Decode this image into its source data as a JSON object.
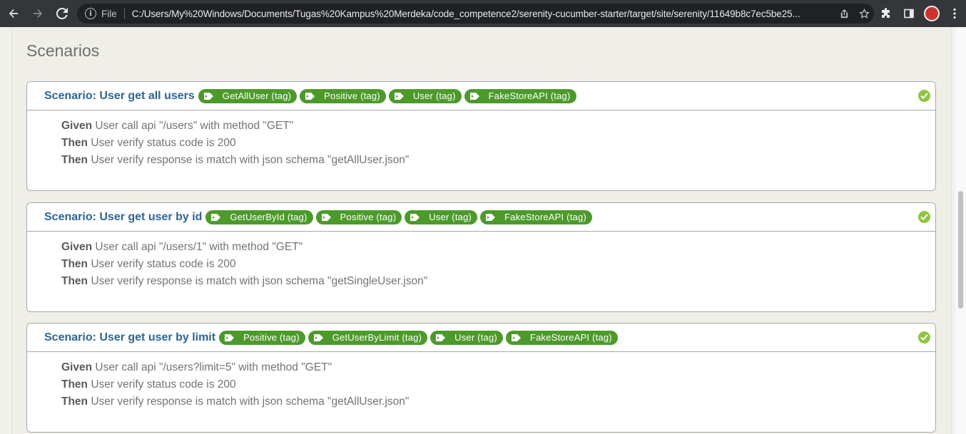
{
  "browser": {
    "file_label": "File",
    "url": "C:/Users/My%20Windows/Documents/Tugas%20Kampus%20Merdeka/code_competence2/serenity-cucumber-starter/target/site/serenity/11649b8c7ec5be25..."
  },
  "page": {
    "section_title": "Scenarios"
  },
  "colors": {
    "tag_bg": "#4c9a2a",
    "title": "#2b6596",
    "passed": "#8dc63f"
  },
  "scenarios": [
    {
      "title": "Scenario: User get all users",
      "tags": [
        "GetAllUser (tag)",
        "Positive (tag)",
        "User (tag)",
        "FakeStoreAPI (tag)"
      ],
      "status_icon": "check-circle-icon",
      "steps": [
        {
          "keyword": "Given",
          "text": "User call api \"/users\" with method \"GET\""
        },
        {
          "keyword": "Then",
          "text": "User verify status code is 200"
        },
        {
          "keyword": "Then",
          "text": "User verify response is match with json schema \"getAllUser.json\""
        }
      ]
    },
    {
      "title": "Scenario: User get user by id",
      "tags": [
        "GetUserById (tag)",
        "Positive (tag)",
        "User (tag)",
        "FakeStoreAPI (tag)"
      ],
      "status_icon": "check-circle-icon",
      "steps": [
        {
          "keyword": "Given",
          "text": "User call api \"/users/1\" with method \"GET\""
        },
        {
          "keyword": "Then",
          "text": "User verify status code is 200"
        },
        {
          "keyword": "Then",
          "text": "User verify response is match with json schema \"getSingleUser.json\""
        }
      ]
    },
    {
      "title": "Scenario: User get user by limit",
      "tags": [
        "Positive (tag)",
        "GetUserByLimit (tag)",
        "User (tag)",
        "FakeStoreAPI (tag)"
      ],
      "status_icon": "check-circle-icon",
      "steps": [
        {
          "keyword": "Given",
          "text": "User call api \"/users?limit=5\" with method \"GET\""
        },
        {
          "keyword": "Then",
          "text": "User verify status code is 200"
        },
        {
          "keyword": "Then",
          "text": "User verify response is match with json schema \"getAllUser.json\""
        }
      ]
    }
  ]
}
